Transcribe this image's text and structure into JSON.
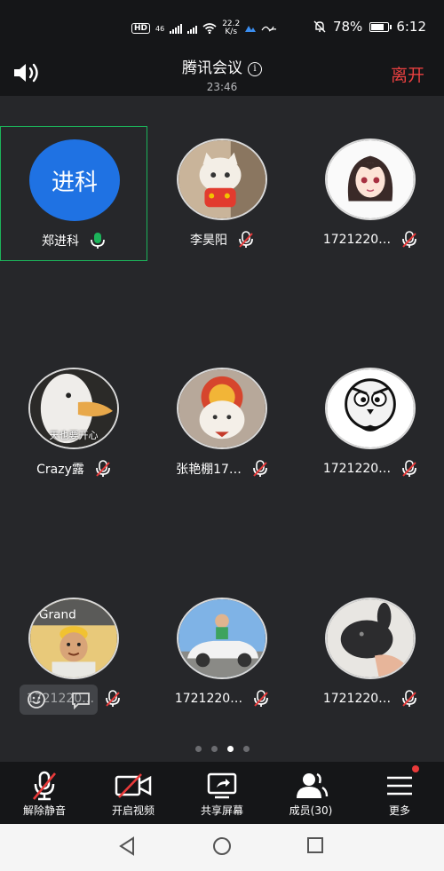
{
  "status": {
    "hd_label": "HD",
    "network_label": "46",
    "speed_value": "22.2",
    "speed_unit": "K/s",
    "battery_pct": "78%",
    "battery_level": 0.78,
    "time": "6:12"
  },
  "header": {
    "title": "腾讯会议",
    "timer": "23:46",
    "leave_label": "离开"
  },
  "participants": [
    {
      "name": "郑进科",
      "initials": "进科",
      "avatar": "initials",
      "mic": "on",
      "active": true
    },
    {
      "name": "李昊阳",
      "avatar": "cat-photo",
      "mic": "muted"
    },
    {
      "name": "1721220…",
      "avatar": "anime-girl",
      "mic": "muted"
    },
    {
      "name": "Crazy露",
      "avatar": "duck-photo",
      "mic": "muted",
      "avatar_caption": "天也要开心"
    },
    {
      "name": "张艳棚17…",
      "avatar": "cat-lion",
      "mic": "muted"
    },
    {
      "name": "1721220…",
      "avatar": "cartoon-face",
      "mic": "muted"
    },
    {
      "name": "1721220…",
      "avatar": "gta-man",
      "mic": "muted"
    },
    {
      "name": "1721220…",
      "avatar": "car-photo",
      "mic": "muted"
    },
    {
      "name": "1721220…",
      "avatar": "rabbit-photo",
      "mic": "muted"
    }
  ],
  "pagination": {
    "total": 4,
    "current": 3
  },
  "toolbar": [
    {
      "label": "解除静音",
      "icon": "mic-muted-icon"
    },
    {
      "label": "开启视频",
      "icon": "video-off-icon"
    },
    {
      "label": "共享屏幕",
      "icon": "share-screen-icon"
    },
    {
      "label": "成员(30)",
      "icon": "members-icon"
    },
    {
      "label": "更多",
      "icon": "more-icon"
    }
  ],
  "colors": {
    "accent_blue": "#1f72e3",
    "leave_red": "#e94040",
    "mute_red": "#e93a3a",
    "speaking_green": "#1cb35a"
  }
}
